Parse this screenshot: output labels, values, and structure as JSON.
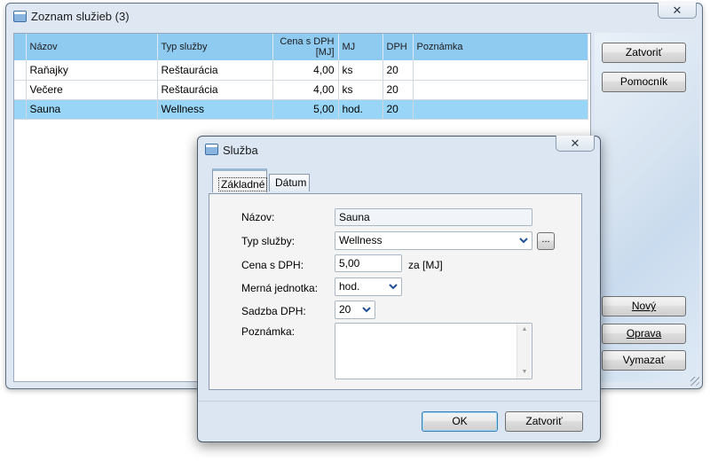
{
  "main_window": {
    "title": "Zoznam služieb (3)",
    "close_glyph": "✕",
    "grid": {
      "columns": [
        "Názov",
        "Typ služby",
        "Cena s DPH\n[MJ]",
        "MJ",
        "DPH",
        "Poznámka"
      ],
      "rows": [
        {
          "nazov": "Raňajky",
          "typ": "Reštaurácia",
          "cena": "4,00",
          "mj": "ks",
          "dph": "20",
          "poznamka": ""
        },
        {
          "nazov": "Večere",
          "typ": "Reštaurácia",
          "cena": "4,00",
          "mj": "ks",
          "dph": "20",
          "poznamka": ""
        },
        {
          "nazov": "Sauna",
          "typ": "Wellness",
          "cena": "5,00",
          "mj": "hod.",
          "dph": "20",
          "poznamka": ""
        }
      ],
      "selected_row_index": 2,
      "header_color": "#8fcaf0",
      "selection_color": "#99d5f6"
    },
    "buttons": {
      "close": "Zatvoriť",
      "helper": "Pomocník",
      "new": "Nový",
      "edit": "Oprava",
      "delete": "Vymazať"
    }
  },
  "dialog": {
    "title": "Služba",
    "close_glyph": "✕",
    "tabs": [
      "Základné",
      "Dátum"
    ],
    "active_tab": "Základné",
    "labels": {
      "nazov": "Názov:",
      "typ": "Typ služby:",
      "cena": "Cena s DPH:",
      "jednotka": "Merná jednotka:",
      "dph": "Sadzba DPH:",
      "poznamka": "Poznámka:"
    },
    "values": {
      "nazov": "Sauna",
      "typ": "Wellness",
      "cena": "5,00",
      "cena_suffix": "za [MJ]",
      "jednotka": "hod.",
      "dph": "20",
      "poznamka": ""
    },
    "browse_button": "...",
    "buttons": {
      "ok": "OK",
      "close": "Zatvoriť"
    }
  }
}
